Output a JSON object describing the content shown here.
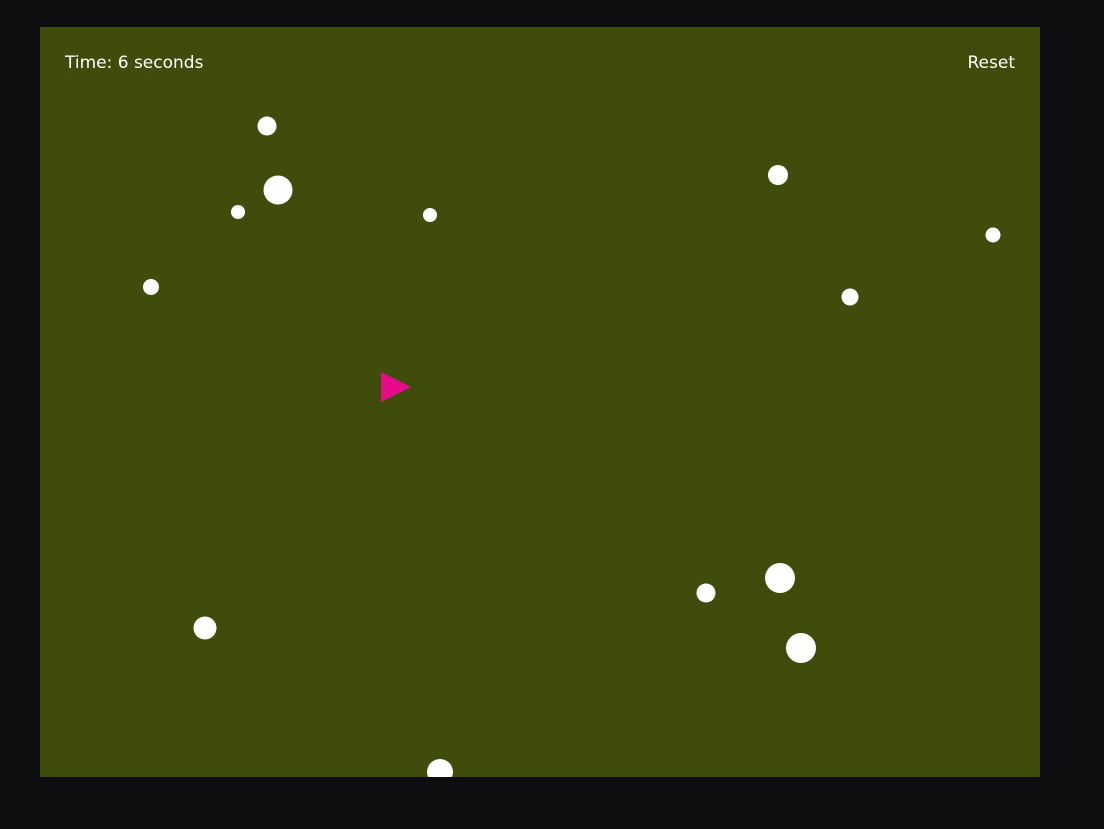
{
  "hud": {
    "time_label": "Time: 6 seconds",
    "reset_label": "Reset"
  },
  "colors": {
    "board": "#404c0b",
    "ball": "#ffffff",
    "player": "#e60b8c",
    "page": "#0e0d0f"
  },
  "icons": {
    "player": "triangle-right-icon",
    "ball": "circle-icon"
  }
}
